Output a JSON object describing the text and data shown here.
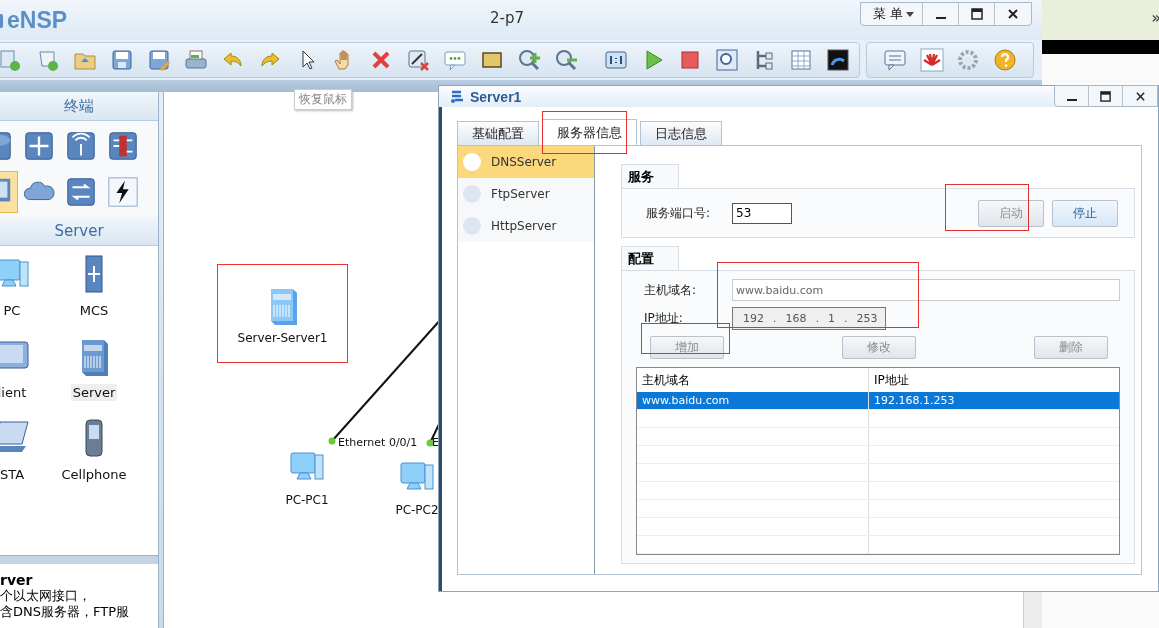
{
  "main_window": {
    "app_name": "eNSP",
    "title": "2-p7",
    "menu": "菜 单"
  },
  "other_window": {
    "chevron": "»"
  },
  "tooltip": "恢复鼠标",
  "palette": {
    "header": "终端",
    "categories": [
      {
        "kind": "router",
        "selected": false
      },
      {
        "kind": "switch",
        "selected": false
      },
      {
        "kind": "wireless",
        "selected": false
      },
      {
        "kind": "firewall",
        "selected": false
      },
      {
        "kind": "terminal",
        "selected": true
      },
      {
        "kind": "cloud",
        "selected": false
      },
      {
        "kind": "hub",
        "selected": false
      },
      {
        "kind": "power",
        "selected": false
      }
    ],
    "subheader": "Server",
    "devices": [
      {
        "kind": "pc",
        "label": "PC",
        "selected": false
      },
      {
        "kind": "mcs",
        "label": "MCS",
        "selected": false
      },
      {
        "kind": "client",
        "label": "lient",
        "selected": false
      },
      {
        "kind": "server",
        "label": "Server",
        "selected": true
      },
      {
        "kind": "sta",
        "label": "STA",
        "selected": false
      },
      {
        "kind": "phone",
        "label": "Cellphone",
        "selected": false
      }
    ]
  },
  "description": {
    "title": "rver",
    "lines": [
      "个以太网接口，",
      "含DNS服务器，FTP服"
    ]
  },
  "canvas": {
    "nodes": [
      {
        "kind": "server",
        "label": "Server-Server1",
        "highlighted": true
      },
      {
        "kind": "pc",
        "label": "PC-PC1",
        "highlighted": false
      },
      {
        "kind": "pc",
        "label": "PC-PC2",
        "highlighted": false
      }
    ],
    "links": [
      {
        "label": "Ethernet 0/0/1"
      },
      {
        "label": "E"
      }
    ]
  },
  "dialog": {
    "title": "Server1",
    "tabs": [
      {
        "label": "基础配置",
        "selected": false
      },
      {
        "label": "服务器信息",
        "selected": true
      }
    ],
    "tab_extra": {
      "label": "日志信息",
      "selected": false
    },
    "services": [
      {
        "label": "DNSServer",
        "selected": true
      },
      {
        "label": "FtpServer",
        "selected": false
      },
      {
        "label": "HttpServer",
        "selected": false
      }
    ],
    "service_section": {
      "title": "服务",
      "port_label": "服务端口号:",
      "port_value": "53",
      "buttons": [
        {
          "label": "启动",
          "disabled": true
        },
        {
          "label": "停止",
          "disabled": false
        }
      ]
    },
    "config_section": {
      "title": "配置",
      "host_label": "主机域名:",
      "host_value": "www.baidu.com",
      "ip_label": "IP地址:",
      "ip_octets": [
        "192",
        "168",
        "1",
        "253"
      ],
      "ip_separator": ".",
      "buttons": [
        {
          "label": "增加",
          "disabled": true
        },
        {
          "label": "修改",
          "disabled": true
        },
        {
          "label": "删除",
          "disabled": true
        }
      ]
    },
    "table": {
      "columns": [
        "主机域名",
        "IP地址"
      ],
      "rows": [
        {
          "cells": [
            "www.baidu.com",
            "192.168.1.253"
          ],
          "selected": true
        }
      ]
    }
  }
}
